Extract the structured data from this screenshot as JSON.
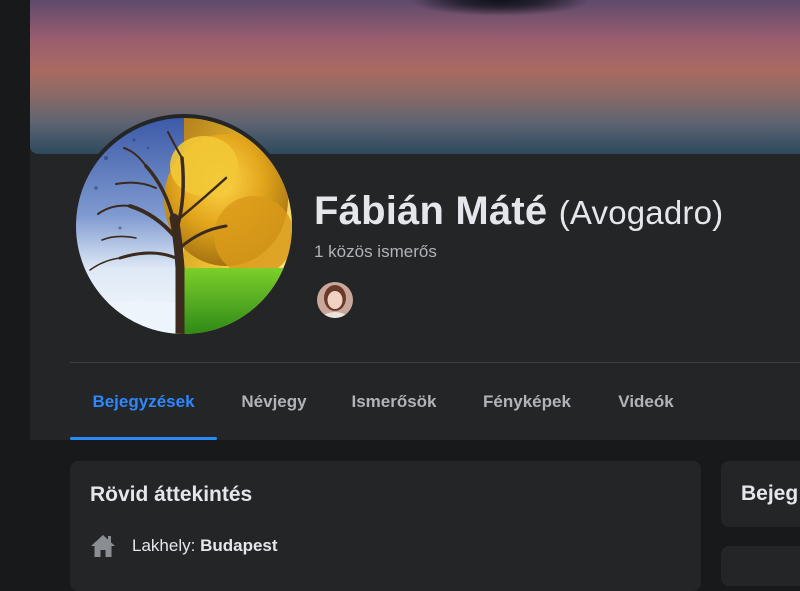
{
  "profile": {
    "name": "Fábián Máté",
    "nickname": "(Avogadro)",
    "mutual_friends": "1 közös ismerős"
  },
  "tabs": [
    {
      "label": "Bejegyzések",
      "active": true
    },
    {
      "label": "Névjegy",
      "active": false
    },
    {
      "label": "Ismerősök",
      "active": false
    },
    {
      "label": "Fényképek",
      "active": false
    },
    {
      "label": "Videók",
      "active": false
    }
  ],
  "intro": {
    "title": "Rövid áttekintés",
    "residence_label": "Lakhely:",
    "residence_value": "Budapest",
    "icon": "home-icon"
  },
  "posts_card": {
    "title": "Bejeg"
  },
  "colors": {
    "accent": "#2d88ff",
    "panel": "#242526",
    "background": "#18191a",
    "text_primary": "#e4e6eb",
    "text_secondary": "#b0b3b8"
  }
}
